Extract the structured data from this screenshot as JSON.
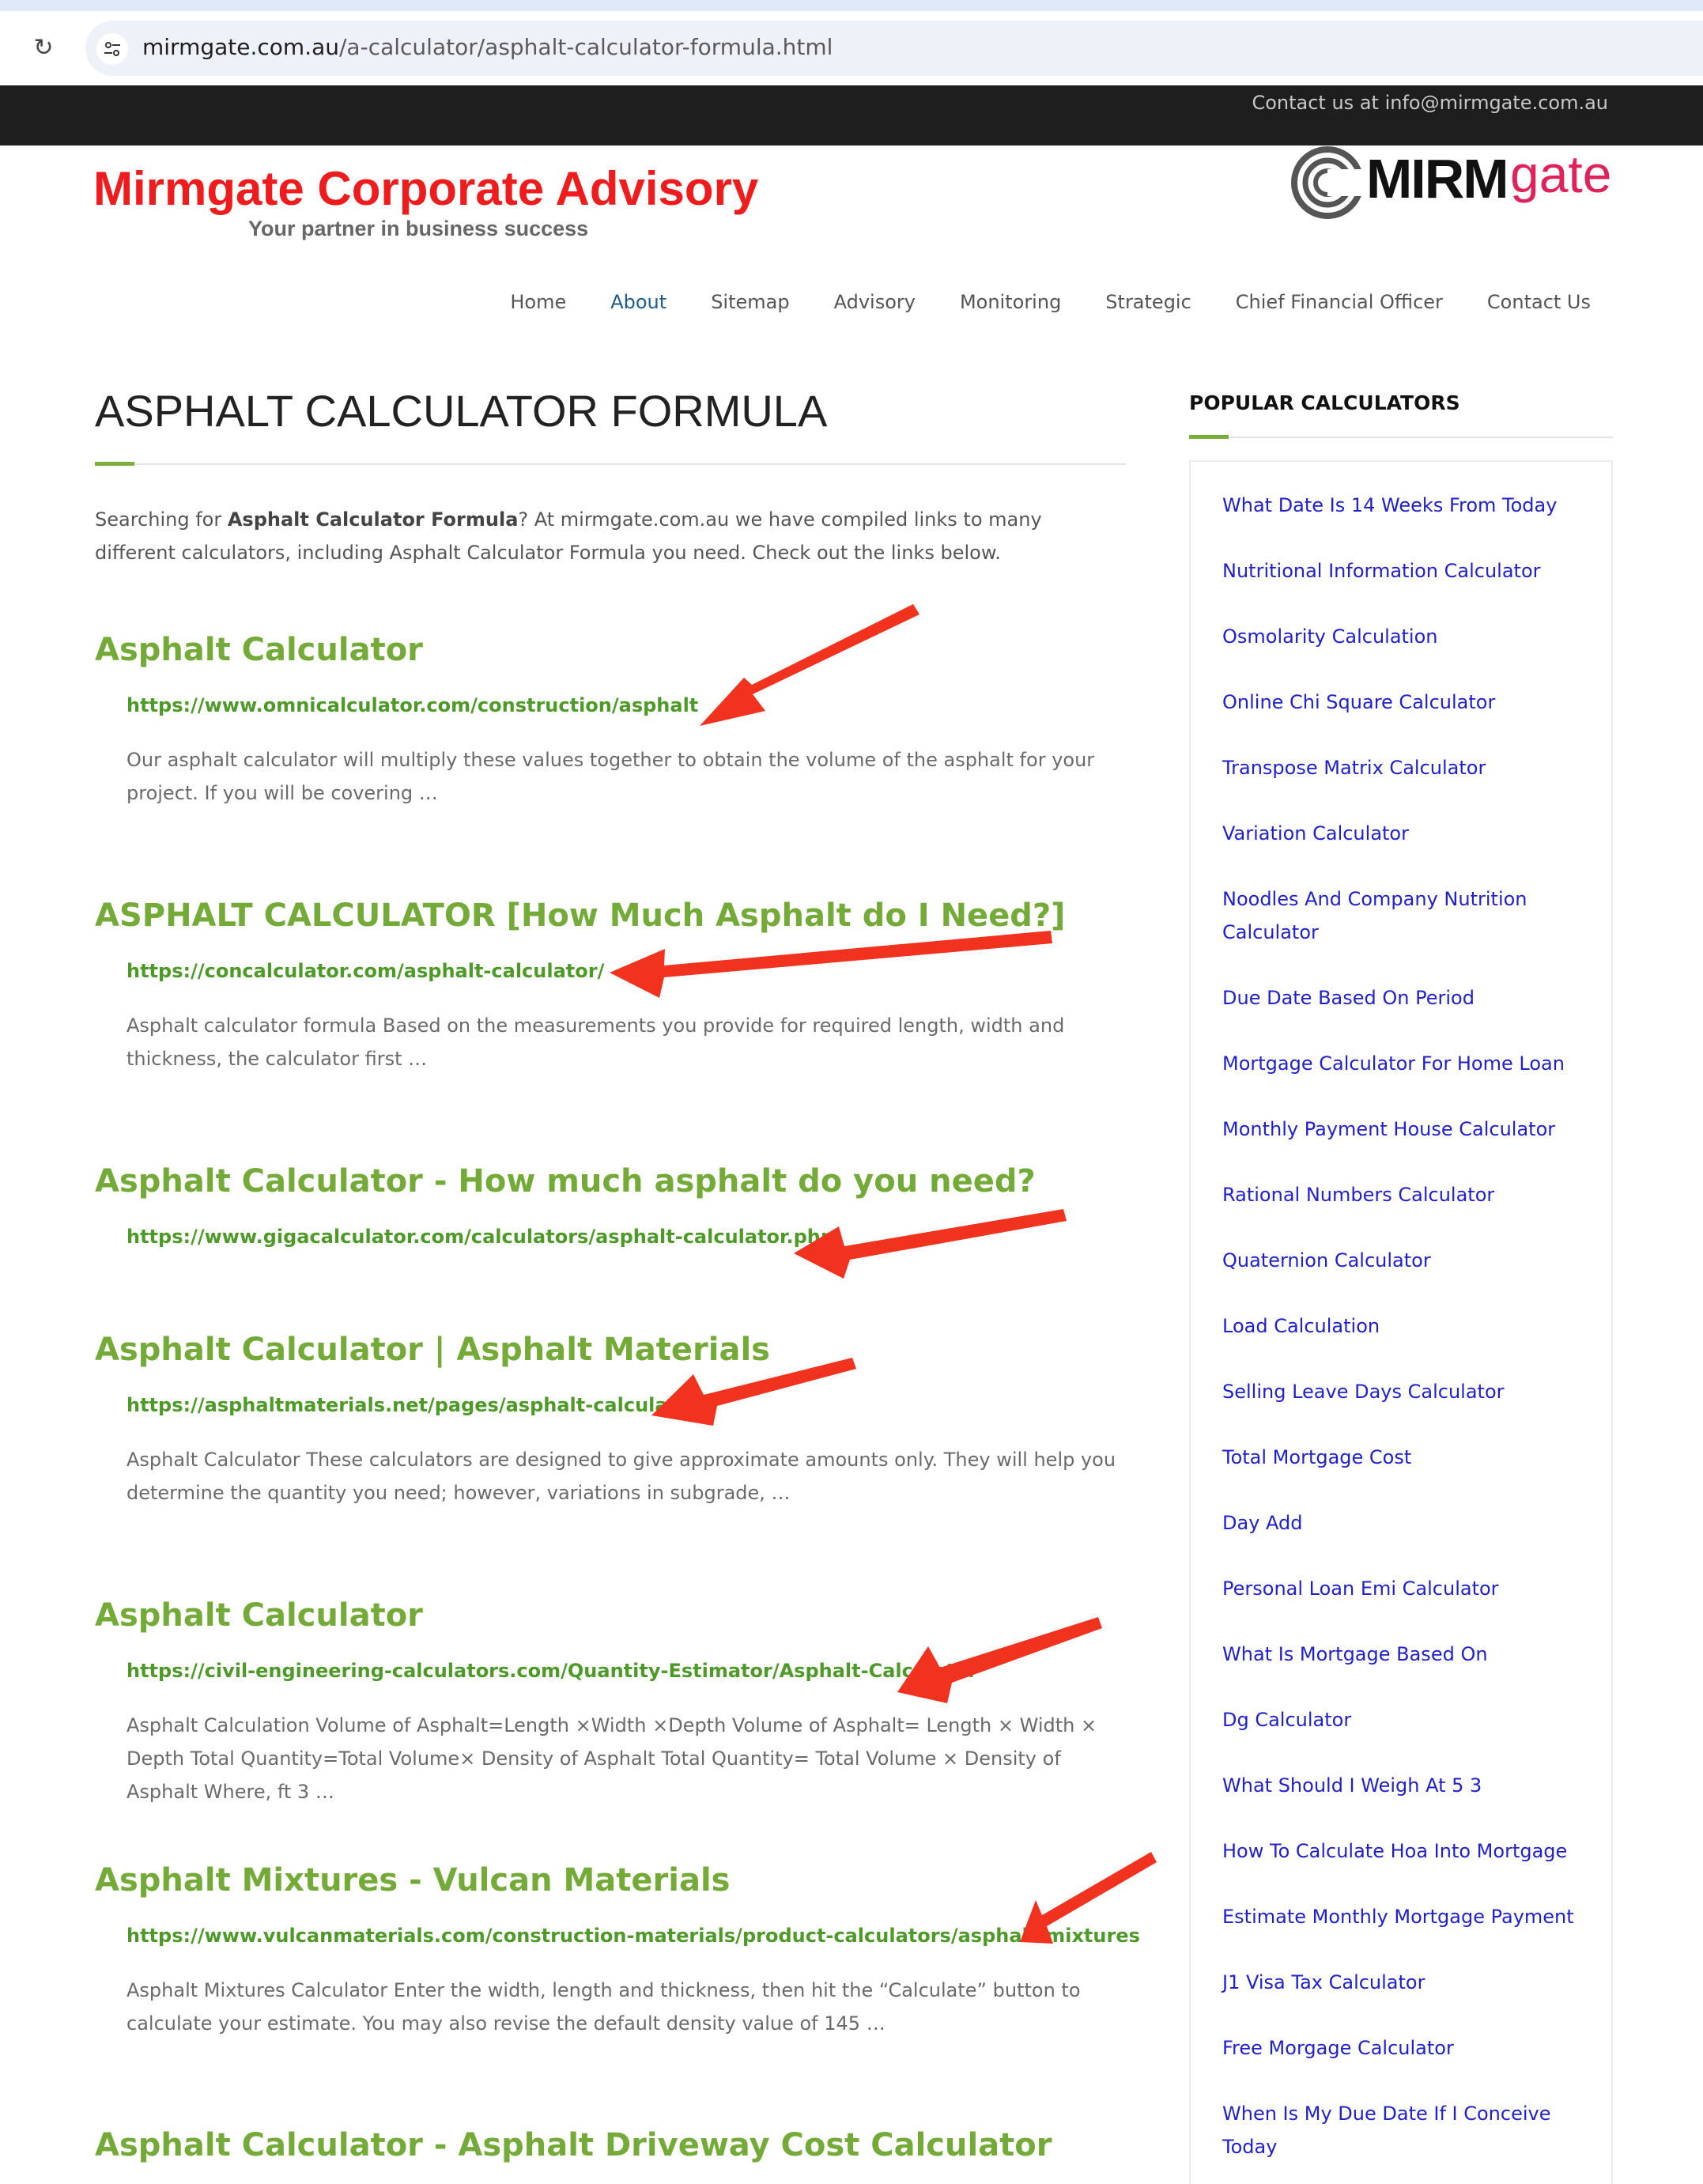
{
  "browser": {
    "url_domain": "mirmgate.com.au",
    "url_path": "/a-calculator/asphalt-calculator-formula.html"
  },
  "topbar": {
    "contact": "Contact us at info@mirmgate.com.au"
  },
  "header": {
    "brand_title": "Mirmgate Corporate Advisory",
    "brand_tagline": "Your partner in business success",
    "logo_text_main": "MIRM",
    "logo_text_accent": "gate"
  },
  "nav": {
    "items": [
      {
        "label": "Home"
      },
      {
        "label": "About"
      },
      {
        "label": "Sitemap"
      },
      {
        "label": "Advisory"
      },
      {
        "label": "Monitoring"
      },
      {
        "label": "Strategic"
      },
      {
        "label": "Chief Financial Officer"
      },
      {
        "label": "Contact Us"
      }
    ],
    "active": "About"
  },
  "main": {
    "title": "ASPHALT CALCULATOR FORMULA",
    "intro_pre": "Searching for ",
    "intro_bold": "Asphalt Calculator Formula",
    "intro_post": "? At mirmgate.com.au we have compiled links to many different calculators, including Asphalt Calculator Formula you need. Check out the links below.",
    "results": [
      {
        "title": "Asphalt Calculator",
        "url": "https://www.omnicalculator.com/construction/asphalt",
        "desc": "Our asphalt calculator will multiply these values together to obtain the volume of the asphalt for your project. If you will be covering …"
      },
      {
        "title": "ASPHALT CALCULATOR [How Much Asphalt do I Need?]",
        "url": "https://concalculator.com/asphalt-calculator/",
        "desc": "Asphalt calculator formula Based on the measurements you provide for required length, width and thickness, the calculator first …"
      },
      {
        "title": "Asphalt Calculator - How much asphalt do you need?",
        "url": "https://www.gigacalculator.com/calculators/asphalt-calculator.php",
        "desc": ""
      },
      {
        "title": "Asphalt Calculator | Asphalt Materials",
        "url": "https://asphaltmaterials.net/pages/asphalt-calculator",
        "desc": "Asphalt Calculator These calculators are designed to give approximate amounts only. They will help you determine the quantity you need; however, variations in subgrade, …"
      },
      {
        "title": "Asphalt Calculator",
        "url": "https://civil-engineering-calculators.com/Quantity-Estimator/Asphalt-Calculator",
        "desc": "Asphalt Calculation Volume of Asphalt=Length ×Width ×Depth Volume of Asphalt= Length × Width × Depth Total Quantity=Total Volume× Density of Asphalt Total Quantity= Total Volume × Density of Asphalt Where, ft 3 …"
      },
      {
        "title": "Asphalt Mixtures - Vulcan Materials",
        "url": "https://www.vulcanmaterials.com/construction-materials/product-calculators/asphalt-mixtures",
        "desc": "Asphalt Mixtures Calculator Enter the width, length and thickness, then hit the “Calculate” button to calculate your estimate. You may also revise the default density value of 145 …"
      },
      {
        "title": "Asphalt Calculator - Asphalt Driveway Cost Calculator",
        "url": "",
        "desc": ""
      }
    ]
  },
  "sidebar": {
    "title": "POPULAR CALCULATORS",
    "items": [
      {
        "label": "What Date Is 14 Weeks From Today"
      },
      {
        "label": "Nutritional Information Calculator"
      },
      {
        "label": "Osmolarity Calculation"
      },
      {
        "label": "Online Chi Square Calculator"
      },
      {
        "label": "Transpose Matrix Calculator"
      },
      {
        "label": "Variation Calculator"
      },
      {
        "label": "Noodles And Company Nutrition Calculator"
      },
      {
        "label": "Due Date Based On Period"
      },
      {
        "label": "Mortgage Calculator For Home Loan"
      },
      {
        "label": "Monthly Payment House Calculator"
      },
      {
        "label": "Rational Numbers Calculator"
      },
      {
        "label": "Quaternion Calculator"
      },
      {
        "label": "Load Calculation"
      },
      {
        "label": "Selling Leave Days Calculator"
      },
      {
        "label": "Total Mortgage Cost"
      },
      {
        "label": "Day Add"
      },
      {
        "label": "Personal Loan Emi Calculator"
      },
      {
        "label": "What Is Mortgage Based On"
      },
      {
        "label": "Dg Calculator"
      },
      {
        "label": "What Should I Weigh At 5 3"
      },
      {
        "label": "How To Calculate Hoa Into Mortgage"
      },
      {
        "label": "Estimate Monthly Mortgage Payment"
      },
      {
        "label": "J1 Visa Tax Calculator"
      },
      {
        "label": "Free Morgage Calculator"
      },
      {
        "label": "When Is My Due Date If I Conceive Today"
      }
    ]
  },
  "colors": {
    "brand_red": "#ee1c1c",
    "result_title_green": "#74ab38",
    "result_link_green": "#4e9a28",
    "sidebar_link_blue": "#2020cc",
    "annotation_arrow_red": "#f0321e",
    "nav_active_blue": "#1e5b8f"
  },
  "annotations": {
    "arrow_count": 6,
    "arrow_color": "#f0321e"
  }
}
